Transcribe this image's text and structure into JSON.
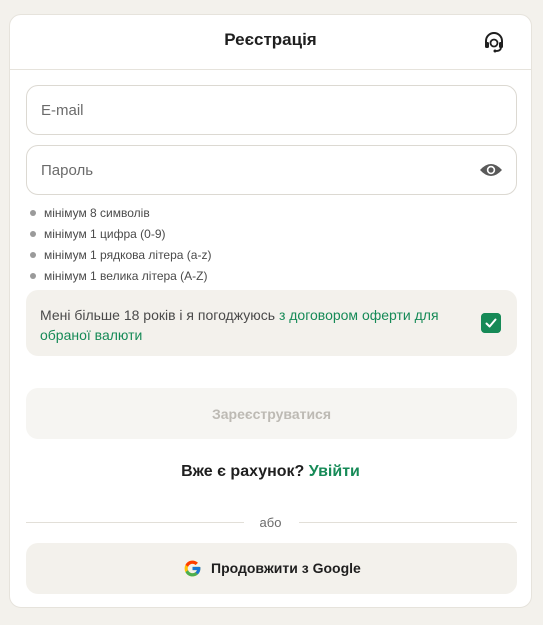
{
  "header": {
    "title": "Реєстрація",
    "support_icon": "headset-icon"
  },
  "form": {
    "email": {
      "value": "",
      "placeholder": "E-mail"
    },
    "password": {
      "value": "",
      "placeholder": "Пароль",
      "toggle_icon": "eye-icon"
    },
    "password_rules": [
      "мінімум 8 символів",
      "мінімум 1 цифра (0-9)",
      "мінімум 1 рядкова літера (a-z)",
      "мінімум 1 велика літера (A-Z)"
    ],
    "agreement": {
      "text": "Мені більше 18 років і я погоджуюсь ",
      "link": "з договором оферти для обраної валюти",
      "checked": true
    },
    "submit_label": "Зареєструватися"
  },
  "login": {
    "question": "Вже є рахунок? ",
    "link": "Увійти"
  },
  "divider": "або",
  "google": {
    "label": "Продовжити з Google",
    "icon": "google-icon"
  },
  "colors": {
    "accent": "#168a57",
    "background": "#f3f1ec",
    "card": "#ffffff",
    "disabled_text": "#bdbab4"
  }
}
